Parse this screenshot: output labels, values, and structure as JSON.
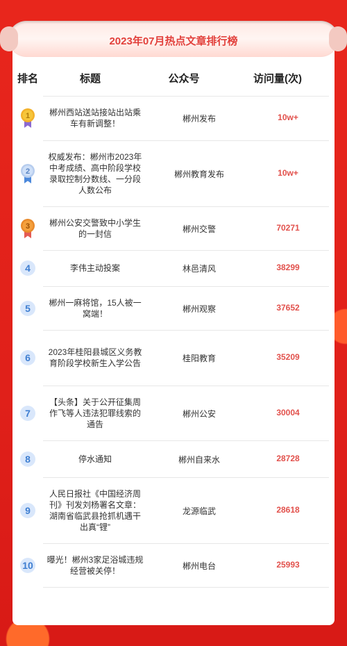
{
  "title": "2023年07月热点文章排行榜",
  "headers": {
    "rank": "排名",
    "title": "标题",
    "account": "公众号",
    "visits": "访问量(次)"
  },
  "rows": [
    {
      "rank": "1",
      "medal": "gold",
      "title": "郴州西站送站接站出站乘车有新调整！",
      "account": "郴州发布",
      "visits": "10w+"
    },
    {
      "rank": "2",
      "medal": "silver",
      "title": "权威发布：郴州市2023年中考成绩、高中阶段学校录取控制分数线、一分段人数公布",
      "account": "郴州教育发布",
      "visits": "10w+"
    },
    {
      "rank": "3",
      "medal": "bronze",
      "title": "郴州公安交警致中小学生的一封信",
      "account": "郴州交警",
      "visits": "70271"
    },
    {
      "rank": "4",
      "title": "李伟主动投案",
      "account": "林邑清风",
      "visits": "38299"
    },
    {
      "rank": "5",
      "title": "郴州一麻将馆，15人被一窝端！",
      "account": "郴州观察",
      "visits": "37652"
    },
    {
      "rank": "6",
      "title": "2023年桂阳县城区义务教育阶段学校新生入学公告",
      "account": "桂阳教育",
      "visits": "35209"
    },
    {
      "rank": "7",
      "title": "【头条】关于公开征集周作飞等人违法犯罪线索的通告",
      "account": "郴州公安",
      "visits": "30004"
    },
    {
      "rank": "8",
      "title": "停水通知",
      "account": "郴州自来水",
      "visits": "28728"
    },
    {
      "rank": "9",
      "title": "人民日报社《中国经济周刊》刊发刘杨署名文章：湖南省临武县抢抓机遇干出真“锂”",
      "account": "龙源临武",
      "visits": "28618"
    },
    {
      "rank": "10",
      "title": "曝光！郴州3家足浴城违规经营被关停！",
      "account": "郴州电台",
      "visits": "25993"
    }
  ]
}
